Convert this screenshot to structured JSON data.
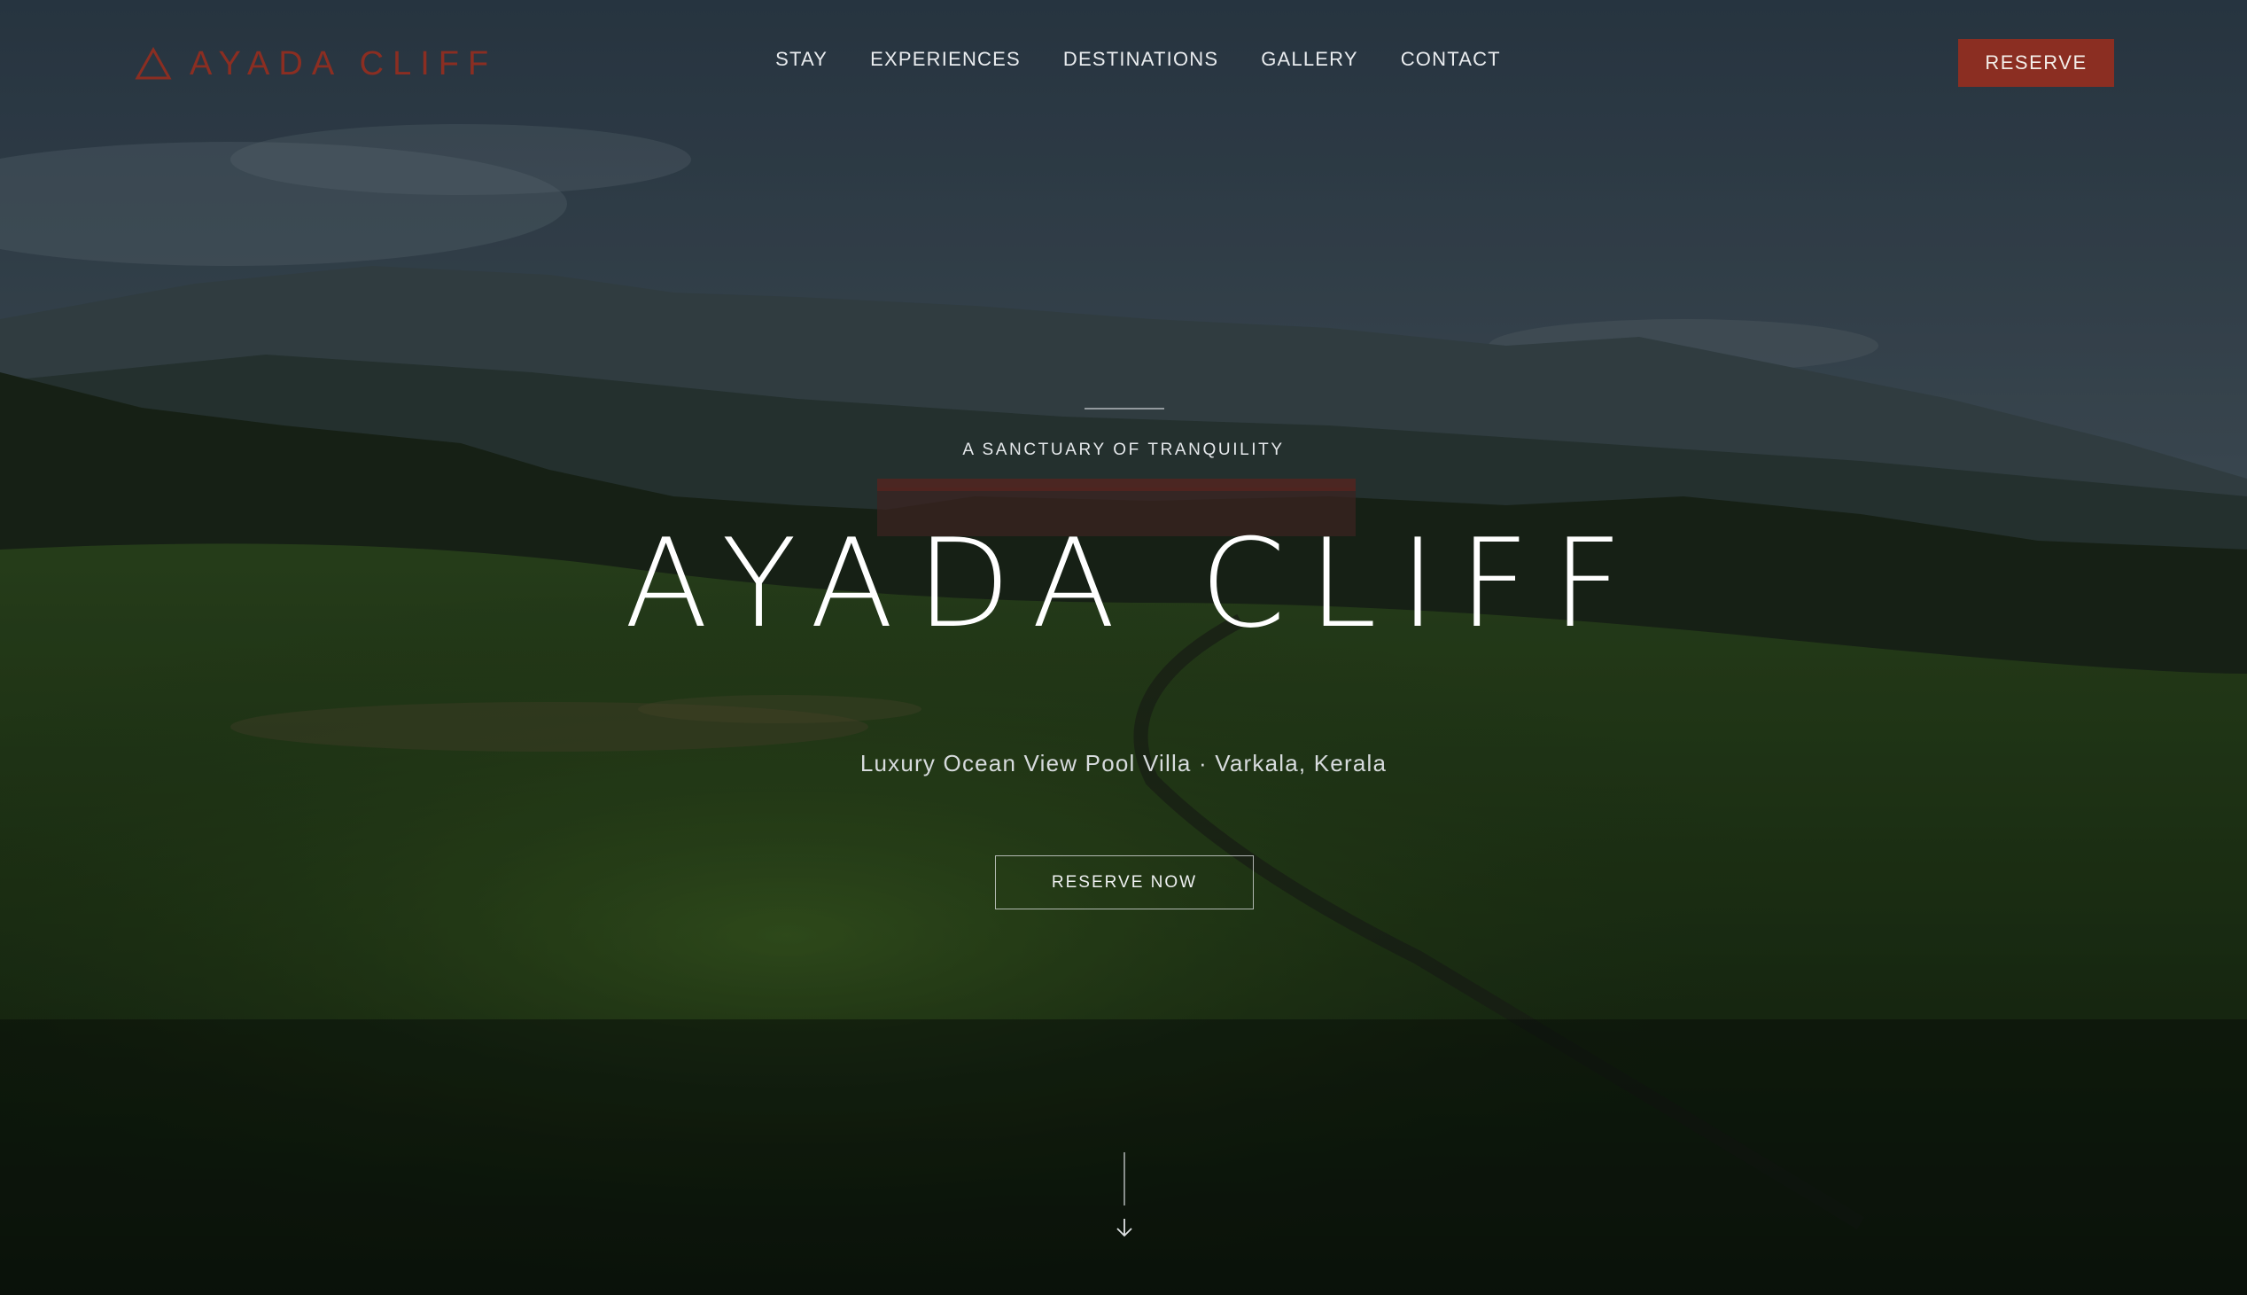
{
  "header": {
    "logo_text": "AYADA CLIFF",
    "logo_icon": "triangle-icon",
    "nav": [
      {
        "label": "STAY"
      },
      {
        "label": "EXPERIENCES"
      },
      {
        "label": "DESTINATIONS"
      },
      {
        "label": "GALLERY"
      },
      {
        "label": "CONTACT"
      }
    ],
    "reserve_label": "RESERVE"
  },
  "hero": {
    "tagline": "A SANCTUARY OF TRANQUILITY",
    "title": "AYADA CLIFF",
    "subtitle": "Luxury Ocean View Pool Villa · Varkala, Kerala",
    "cta_label": "RESERVE NOW",
    "scroll_icon": "arrow-down-icon"
  },
  "colors": {
    "accent": "#8b2e22",
    "text_light": "#e9ecef"
  }
}
